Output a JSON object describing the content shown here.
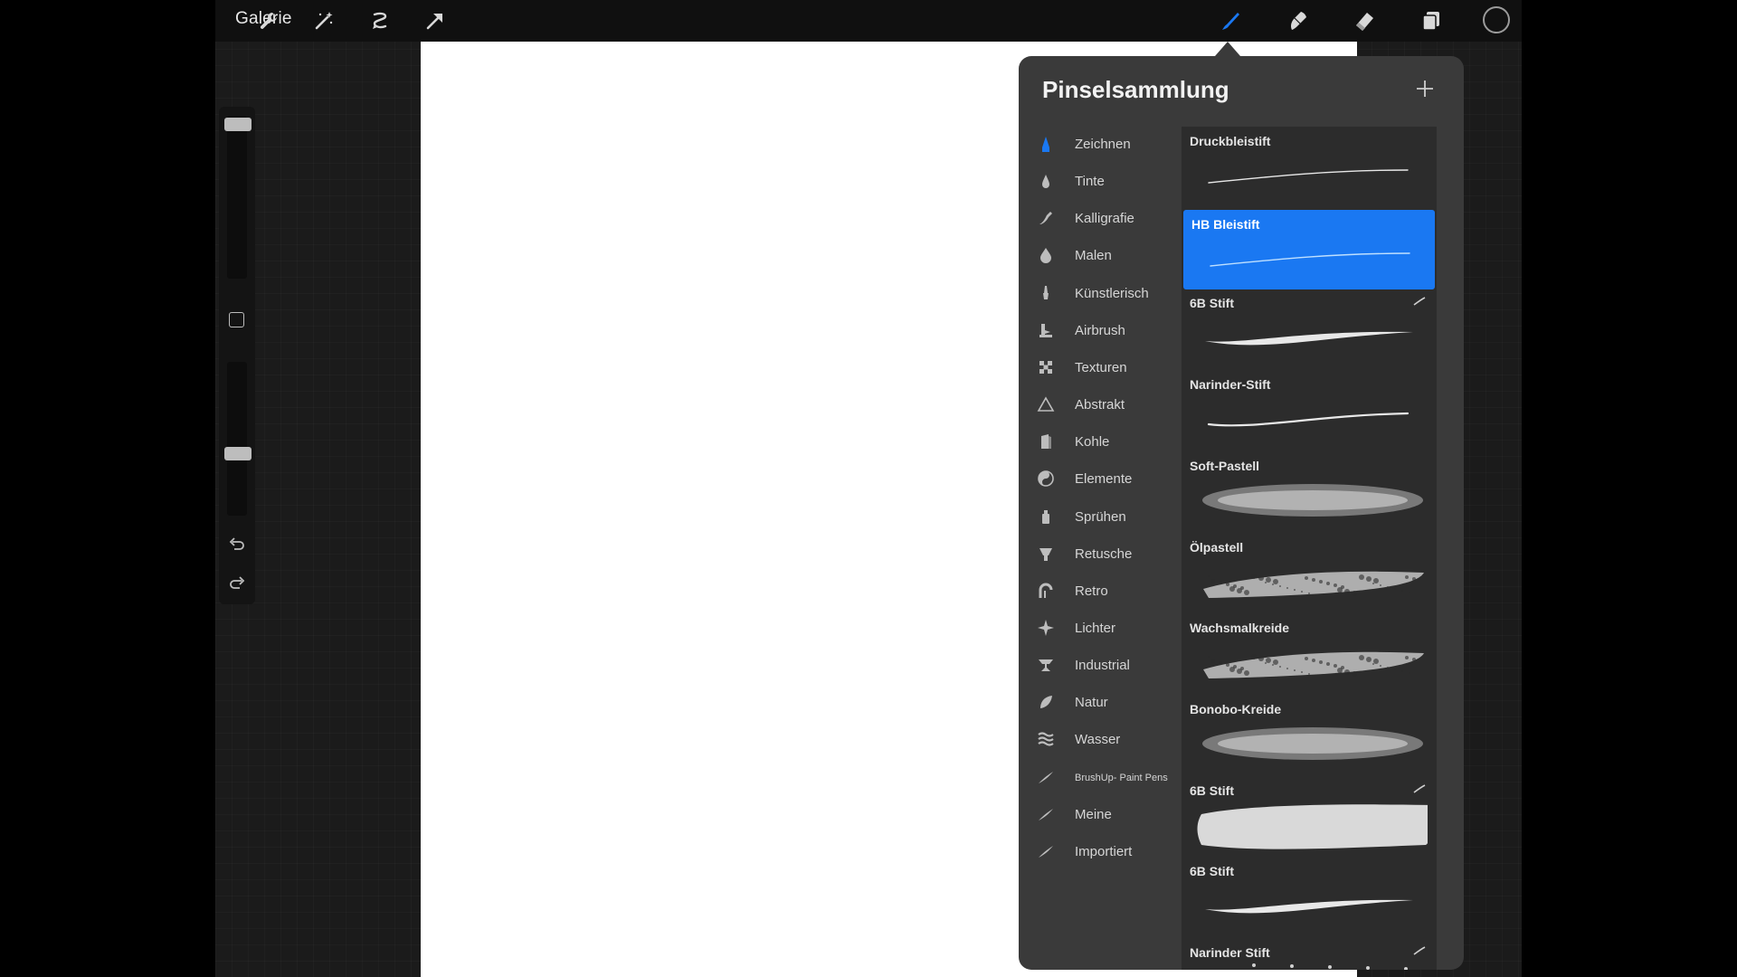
{
  "topbar": {
    "gallery_label": "Galerie",
    "left_icons": [
      "wrench-icon",
      "magic-wand-icon",
      "selection-icon",
      "transform-arrow-icon"
    ],
    "right_icons": [
      "brush-icon",
      "smudge-icon",
      "eraser-icon",
      "layers-icon"
    ],
    "active_tool": "brush-icon",
    "active_color": "#111111",
    "accent_color": "#1a78f2"
  },
  "sidebar": {
    "icons": [
      "modify-square-icon",
      "undo-icon",
      "redo-icon"
    ]
  },
  "panel": {
    "title": "Pinselsammlung",
    "add_icon": "plus-icon",
    "categories": [
      {
        "label": "Zeichnen",
        "icon": "pencil-tip-icon",
        "active": true
      },
      {
        "label": "Tinte",
        "icon": "ink-drop-icon"
      },
      {
        "label": "Kalligrafie",
        "icon": "calligraphy-icon"
      },
      {
        "label": "Malen",
        "icon": "paint-drop-icon"
      },
      {
        "label": "Künstlerisch",
        "icon": "artistic-brush-icon"
      },
      {
        "label": "Airbrush",
        "icon": "airbrush-icon"
      },
      {
        "label": "Texturen",
        "icon": "texture-icon"
      },
      {
        "label": "Abstrakt",
        "icon": "triangle-icon"
      },
      {
        "label": "Kohle",
        "icon": "charcoal-icon"
      },
      {
        "label": "Elemente",
        "icon": "yin-yang-icon"
      },
      {
        "label": "Sprühen",
        "icon": "spray-can-icon"
      },
      {
        "label": "Retusche",
        "icon": "retouch-icon"
      },
      {
        "label": "Retro",
        "icon": "retro-icon"
      },
      {
        "label": "Lichter",
        "icon": "sparkle-icon"
      },
      {
        "label": "Industrial",
        "icon": "anvil-icon"
      },
      {
        "label": "Natur",
        "icon": "leaf-icon"
      },
      {
        "label": "Wasser",
        "icon": "water-waves-icon"
      },
      {
        "label": "BrushUp- Paint Pens",
        "icon": "brush-stroke-icon",
        "small": true
      },
      {
        "label": "Meine",
        "icon": "brush-stroke-icon"
      },
      {
        "label": "Importiert",
        "icon": "brush-stroke-icon"
      }
    ],
    "brushes": [
      {
        "name": "Druckbleistift",
        "stroke": "thin"
      },
      {
        "name": "HB Bleistift",
        "stroke": "thin",
        "selected": true
      },
      {
        "name": "6B Stift",
        "stroke": "taper",
        "marked": true
      },
      {
        "name": "Narinder-Stift",
        "stroke": "line"
      },
      {
        "name": "Soft-Pastell",
        "stroke": "soft"
      },
      {
        "name": "Ölpastell",
        "stroke": "rough"
      },
      {
        "name": "Wachsmalkreide",
        "stroke": "rough"
      },
      {
        "name": "Bonobo-Kreide",
        "stroke": "soft"
      },
      {
        "name": "6B Stift",
        "stroke": "thick",
        "marked": true
      },
      {
        "name": "6B Stift",
        "stroke": "taper"
      },
      {
        "name": "Narinder Stift",
        "stroke": "dots",
        "marked": true
      }
    ]
  }
}
